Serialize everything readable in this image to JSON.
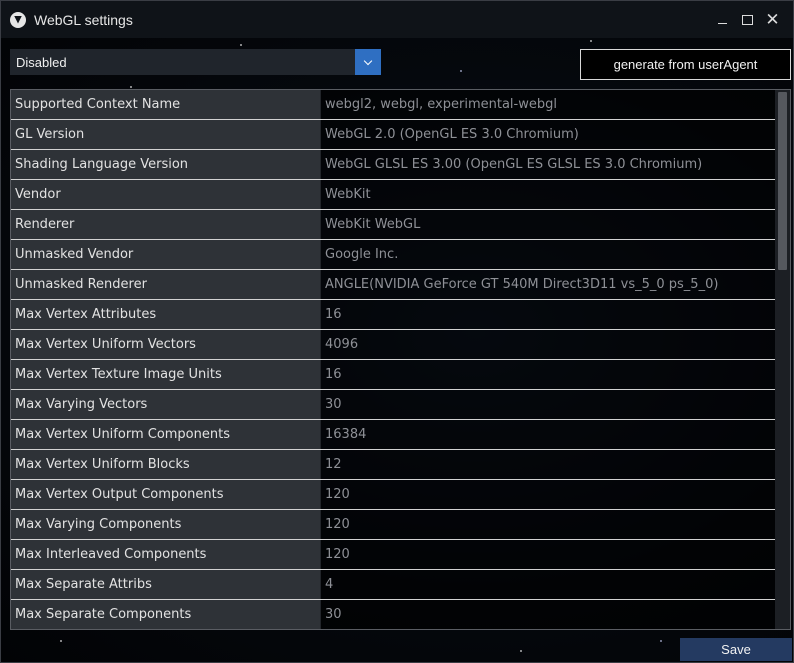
{
  "window": {
    "title": "WebGL settings",
    "app_icon": "app-logo-icon"
  },
  "controls": {
    "minimize": "minimize-icon",
    "maximize": "maximize-icon",
    "close": "close-icon"
  },
  "mode_select": {
    "value": "Disabled",
    "icon": "chevron-down-icon"
  },
  "generate_button": {
    "label": "generate from userAgent"
  },
  "settings": [
    {
      "label": "Supported Context Name",
      "value": "webgl2, webgl, experimental-webgl"
    },
    {
      "label": "GL Version",
      "value": "WebGL 2.0 (OpenGL ES 3.0 Chromium)"
    },
    {
      "label": "Shading Language Version",
      "value": "WebGL GLSL ES 3.00 (OpenGL ES GLSL ES 3.0 Chromium)"
    },
    {
      "label": "Vendor",
      "value": "WebKit"
    },
    {
      "label": "Renderer",
      "value": "WebKit WebGL"
    },
    {
      "label": "Unmasked Vendor",
      "value": "Google Inc."
    },
    {
      "label": "Unmasked Renderer",
      "value": "ANGLE(NVIDIA GeForce GT 540M Direct3D11 vs_5_0 ps_5_0)"
    },
    {
      "label": "Max Vertex Attributes",
      "value": "16"
    },
    {
      "label": "Max Vertex Uniform Vectors",
      "value": "4096"
    },
    {
      "label": "Max Vertex Texture Image Units",
      "value": "16"
    },
    {
      "label": "Max Varying Vectors",
      "value": "30"
    },
    {
      "label": "Max Vertex Uniform Components",
      "value": "16384"
    },
    {
      "label": "Max Vertex Uniform Blocks",
      "value": "12"
    },
    {
      "label": "Max Vertex Output Components",
      "value": "120"
    },
    {
      "label": "Max Varying Components",
      "value": "120"
    },
    {
      "label": "Max Interleaved Components",
      "value": "120"
    },
    {
      "label": "Max Separate Attribs",
      "value": "4"
    },
    {
      "label": "Max Separate Components",
      "value": "30"
    }
  ],
  "save_button": {
    "label": "Save"
  },
  "colors": {
    "accent": "#2f6fc2",
    "save": "#243a61",
    "label_bg": "#2e3237"
  }
}
